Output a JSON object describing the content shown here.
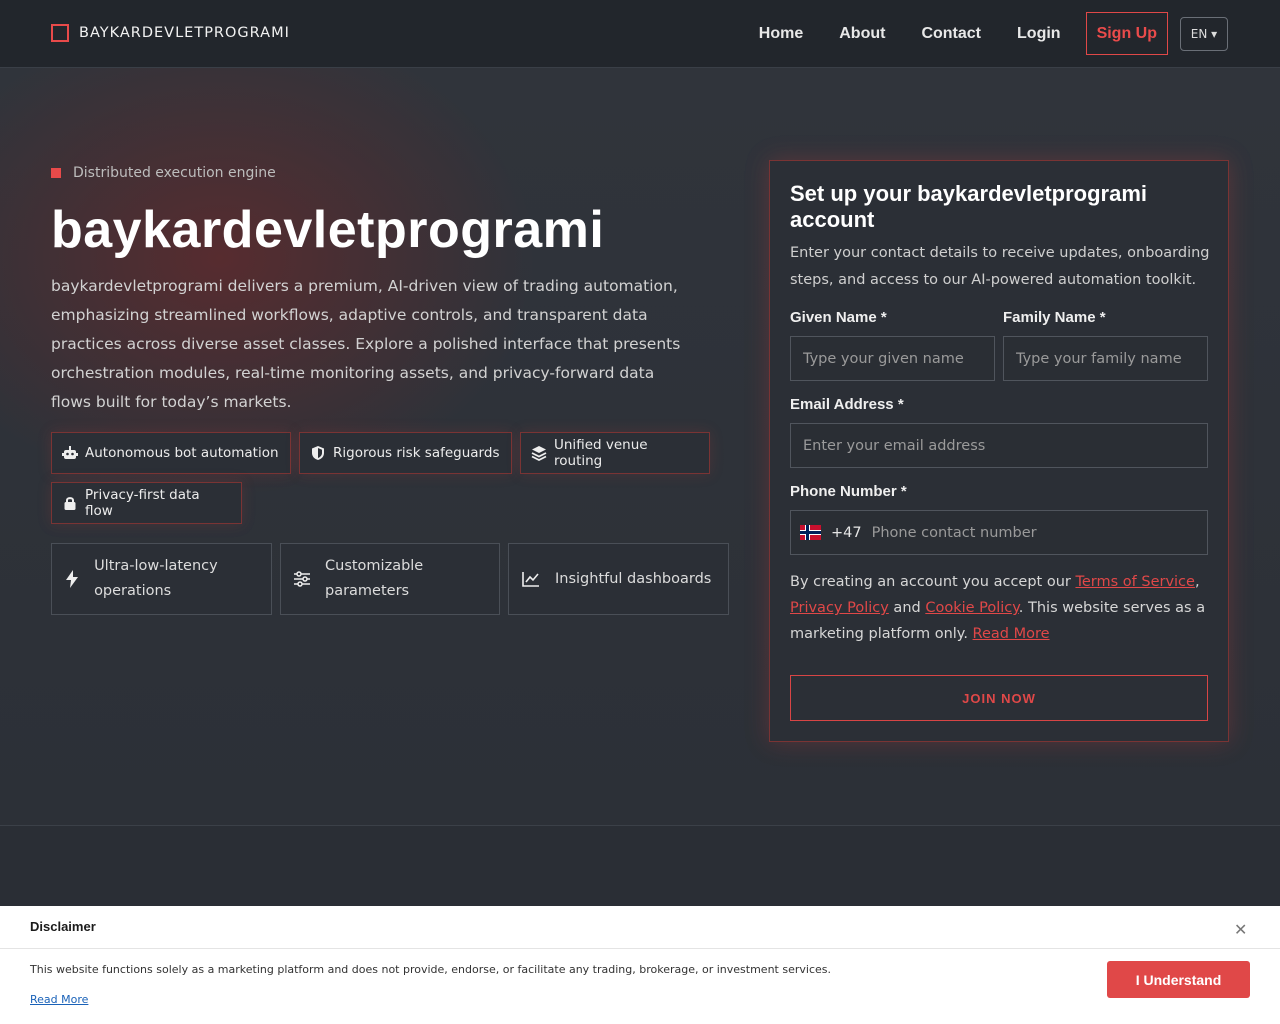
{
  "header": {
    "brand": "BAYKARDEVLETPROGRAMI",
    "nav": [
      "Home",
      "About",
      "Contact",
      "Login"
    ],
    "signup": "Sign Up",
    "lang": "EN ▾"
  },
  "hero": {
    "eyebrow": "Distributed execution engine",
    "title": "baykardevletprogrami",
    "description": "baykardevletprogrami delivers a premium, AI-driven view of trading automation, emphasizing streamlined workflows, adaptive controls, and transparent data practices across diverse asset classes. Explore a polished interface that presents orchestration modules, real-time monitoring assets, and privacy-forward data flows built for today’s markets.",
    "pills": [
      {
        "icon": "robot-icon",
        "label": "Autonomous bot automation"
      },
      {
        "icon": "shield-icon",
        "label": "Rigorous risk safeguards"
      },
      {
        "icon": "layers-icon",
        "label": "Unified venue routing"
      },
      {
        "icon": "lock-icon",
        "label": "Privacy-first data flow"
      }
    ],
    "features": [
      {
        "icon": "bolt-icon",
        "label": "Ultra-low-latency operations"
      },
      {
        "icon": "sliders-icon",
        "label": "Customizable parameters"
      },
      {
        "icon": "chart-line-icon",
        "label": "Insightful dashboards"
      }
    ]
  },
  "form": {
    "title": "Set up your baykardevletprogrami account",
    "subtitle": "Enter your contact details to receive updates, onboarding steps, and access to our AI-powered automation toolkit.",
    "given_label": "Given Name *",
    "given_placeholder": "Type your given name",
    "family_label": "Family Name *",
    "family_placeholder": "Type your family name",
    "email_label": "Email Address *",
    "email_placeholder": "Enter your email address",
    "phone_label": "Phone Number *",
    "dial_code": "+47",
    "phone_placeholder": "Phone contact number",
    "terms_prefix": "By creating an account you accept our ",
    "terms_link": "Terms of Service",
    "terms_comma": ",",
    "privacy_link": "Privacy Policy",
    "and": " and ",
    "cookie_link": "Cookie Policy",
    "terms_suffix": ". This website serves as a marketing platform only. ",
    "read_more": "Read More",
    "join": "JOIN NOW"
  },
  "disclaimer": {
    "title": "Disclaimer",
    "text": "This website functions solely as a marketing platform and does not provide, endorse, or facilitate any trading, brokerage, or investment services.",
    "read_more": "Read More",
    "button": "I Understand"
  },
  "colors": {
    "accent": "#e04848",
    "background": "#2a2e35",
    "header": "#22262c"
  }
}
